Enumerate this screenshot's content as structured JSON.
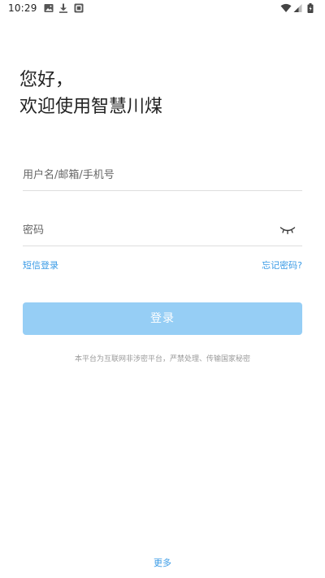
{
  "status_bar": {
    "time": "10:29",
    "left_icons": [
      "image-icon",
      "download-icon",
      "app-notification-icon"
    ],
    "right_icons": [
      "wifi-icon",
      "cell-signal-icon",
      "battery-icon"
    ]
  },
  "greeting": {
    "line1": "您好，",
    "line2": "欢迎使用智慧川煤"
  },
  "form": {
    "username_placeholder": "用户名/邮箱/手机号",
    "password_placeholder": "密码",
    "sms_login": "短信登录",
    "forgot_password": "忘记密码?",
    "login_label": "登录"
  },
  "disclaimer": "本平台为互联网非涉密平台，严禁处理、传输国家秘密",
  "footer": {
    "more": "更多"
  },
  "colors": {
    "accent": "#3a9be6",
    "login_button": "#96cef5",
    "divider": "#dedede",
    "muted_text": "#9a9a9a"
  }
}
